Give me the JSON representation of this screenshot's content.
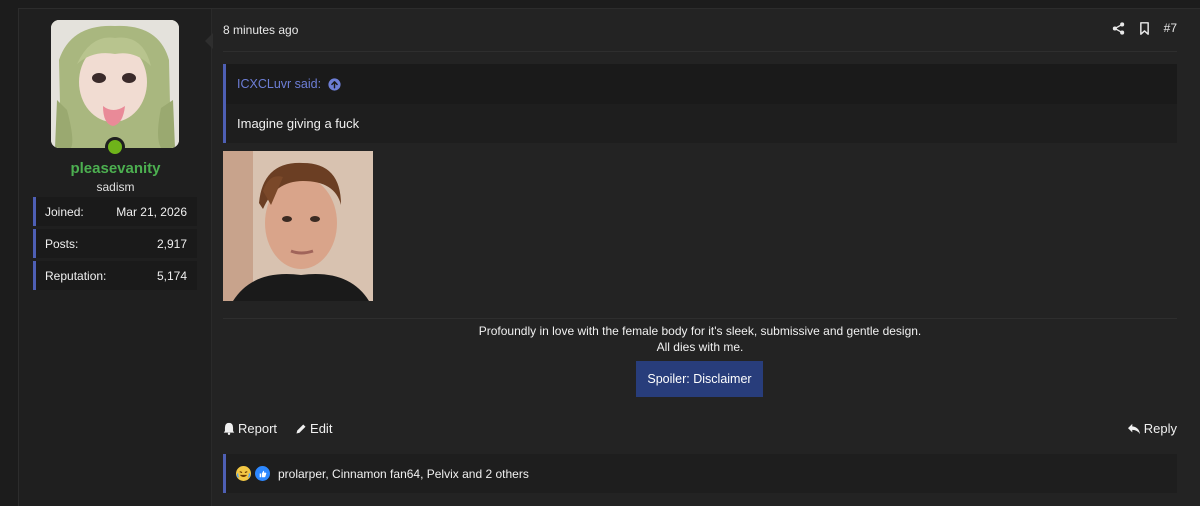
{
  "user": {
    "username": "pleasevanity",
    "title": "sadism",
    "stats": [
      {
        "label": "Joined:",
        "value": "Mar 21, 2026"
      },
      {
        "label": "Posts:",
        "value": "2,917"
      },
      {
        "label": "Reputation:",
        "value": "5,174"
      }
    ],
    "online_color": "#6fb31a",
    "username_color": "#4caf50"
  },
  "post": {
    "timestamp": "8 minutes ago",
    "number": "#7",
    "quote": {
      "author": "ICXCLuvr said:",
      "text": "Imagine giving a fuck"
    },
    "signature": {
      "line1": "Profoundly in love with the female body for it's sleek, submissive and gentle design.",
      "line2": "All dies with me.",
      "spoiler_label": "Spoiler: Disclaimer"
    },
    "actions": {
      "report": "Report",
      "edit": "Edit",
      "reply": "Reply"
    },
    "reactions": {
      "text": "prolarper, Cinnamon fan64, Pelvix and 2 others",
      "icons": [
        "laughing-emoji-icon",
        "like-emoji-icon"
      ]
    }
  },
  "colors": {
    "accent": "#4e5fb4",
    "spoiler_bg": "#283d7b",
    "quote_author": "#6d7ed6"
  }
}
